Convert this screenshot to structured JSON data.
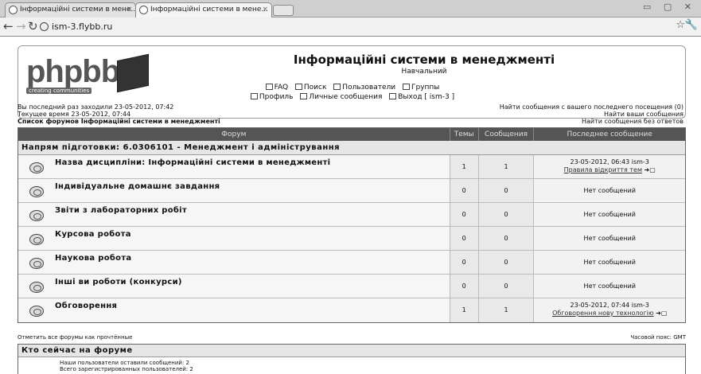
{
  "browser": {
    "tabs": [
      {
        "title": "Інформаційні системи в мене..."
      },
      {
        "title": "Інформаційні системи в мене..."
      }
    ],
    "url": "ism-3.flybb.ru"
  },
  "header": {
    "logo_text": "phpbb",
    "logo_slogan": "creating communities",
    "site_title": "Інформаційні системи в менеджменті",
    "site_desc": "Навчальний",
    "links_row1": [
      "FAQ",
      "Поиск",
      "Пользователи",
      "Группы"
    ],
    "links_row2": [
      "Профиль",
      "Личные сообщения",
      "Выход [ ism-3 ]"
    ]
  },
  "info": {
    "last_visit": "Вы последний раз заходили 23-05-2012, 07:42",
    "current_time": "Текущее время 23-05-2012, 07:44",
    "breadcrumb": "Список форумов Інформаційні системи в менеджменті",
    "right_links": [
      "Найти сообщения с вашего последнего посещения (0)",
      "Найти ваши сообщения",
      "Найти сообщения без ответов"
    ]
  },
  "table": {
    "headers": [
      "Форум",
      "Темы",
      "Сообщения",
      "Последнее сообщение"
    ],
    "category": "Напрям підготовки: 6.0306101 - Менеджмент і адміністрування",
    "rows": [
      {
        "name": "Назва дисципліни: Інформаційні системи в менеджменті",
        "topics": "1",
        "posts": "1",
        "last_line1": "23-05-2012, 06:43 ism-3",
        "last_line2": "Правила відкриття тем"
      },
      {
        "name": "Індивідуальне домашнє завдання",
        "topics": "0",
        "posts": "0",
        "last_line1": "Нет сообщений",
        "last_line2": ""
      },
      {
        "name": "Звіти з лабораторних робіт",
        "topics": "0",
        "posts": "0",
        "last_line1": "Нет сообщений",
        "last_line2": ""
      },
      {
        "name": "Курсова робота",
        "topics": "0",
        "posts": "0",
        "last_line1": "Нет сообщений",
        "last_line2": ""
      },
      {
        "name": "Наукова робота",
        "topics": "0",
        "posts": "0",
        "last_line1": "Нет сообщений",
        "last_line2": ""
      },
      {
        "name": "Інші ви роботи (конкурси)",
        "topics": "0",
        "posts": "0",
        "last_line1": "Нет сообщений",
        "last_line2": ""
      },
      {
        "name": "Обговорення",
        "topics": "1",
        "posts": "1",
        "last_line1": "23-05-2012, 07:44 ism-3",
        "last_line2": "Обговорення нову технологію"
      }
    ]
  },
  "footer": {
    "mark_read": "Отметить все форумы как прочтённые",
    "timezone": "Часовой пояс: GMT",
    "online_title": "Кто сейчас на форуме",
    "online_line1": "Наши пользователи оставили сообщений: 2",
    "online_line2": "Всего зарегистрированных пользователей: 2"
  }
}
